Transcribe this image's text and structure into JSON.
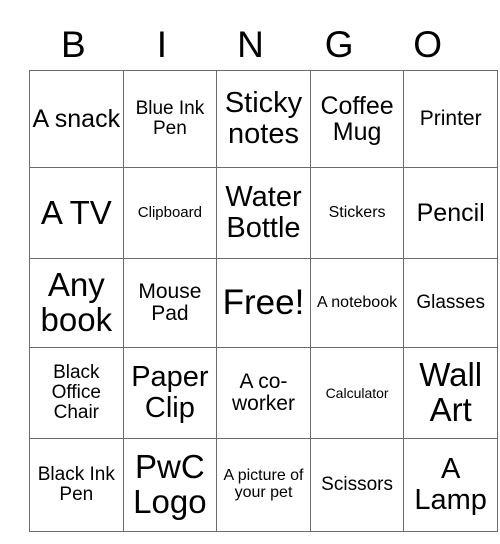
{
  "card": {
    "title": "BINGO",
    "header_letters": [
      "B",
      "I",
      "N",
      "G",
      "O"
    ],
    "border_color": "#6b6b6b",
    "text_color": "#000000",
    "background_color": "#ffffff",
    "rows": [
      [
        {
          "text": "A snack",
          "size": "sz-l"
        },
        {
          "text": "Blue Ink Pen",
          "size": "sz-m"
        },
        {
          "text": "Sticky notes",
          "size": "sz-xl"
        },
        {
          "text": "Coffee Mug",
          "size": "sz-l"
        },
        {
          "text": "Printer",
          "size": "sz-ml"
        }
      ],
      [
        {
          "text": "A TV",
          "size": "sz-xxl"
        },
        {
          "text": "Clipboard",
          "size": "sz-s"
        },
        {
          "text": "Water Bottle",
          "size": "sz-xl"
        },
        {
          "text": "Stickers",
          "size": "sz-sm"
        },
        {
          "text": "Pencil",
          "size": "sz-l"
        }
      ],
      [
        {
          "text": "Any book",
          "size": "sz-xxl"
        },
        {
          "text": "Mouse Pad",
          "size": "sz-ml"
        },
        {
          "text": "Free!",
          "size": "sz-free"
        },
        {
          "text": "A notebook",
          "size": "sz-sm"
        },
        {
          "text": "Glasses",
          "size": "sz-m"
        }
      ],
      [
        {
          "text": "Black Office Chair",
          "size": "sz-m"
        },
        {
          "text": "Paper Clip",
          "size": "sz-xl"
        },
        {
          "text": "A co-worker",
          "size": "sz-ml"
        },
        {
          "text": "Calculator",
          "size": "sz-xs"
        },
        {
          "text": "Wall Art",
          "size": "sz-xxl"
        }
      ],
      [
        {
          "text": "Black Ink Pen",
          "size": "sz-m"
        },
        {
          "text": "PwC Logo",
          "size": "sz-xxl"
        },
        {
          "text": "A picture of your pet",
          "size": "sz-sm"
        },
        {
          "text": "Scissors",
          "size": "sz-m"
        },
        {
          "text": "A Lamp",
          "size": "sz-xl"
        }
      ]
    ]
  }
}
